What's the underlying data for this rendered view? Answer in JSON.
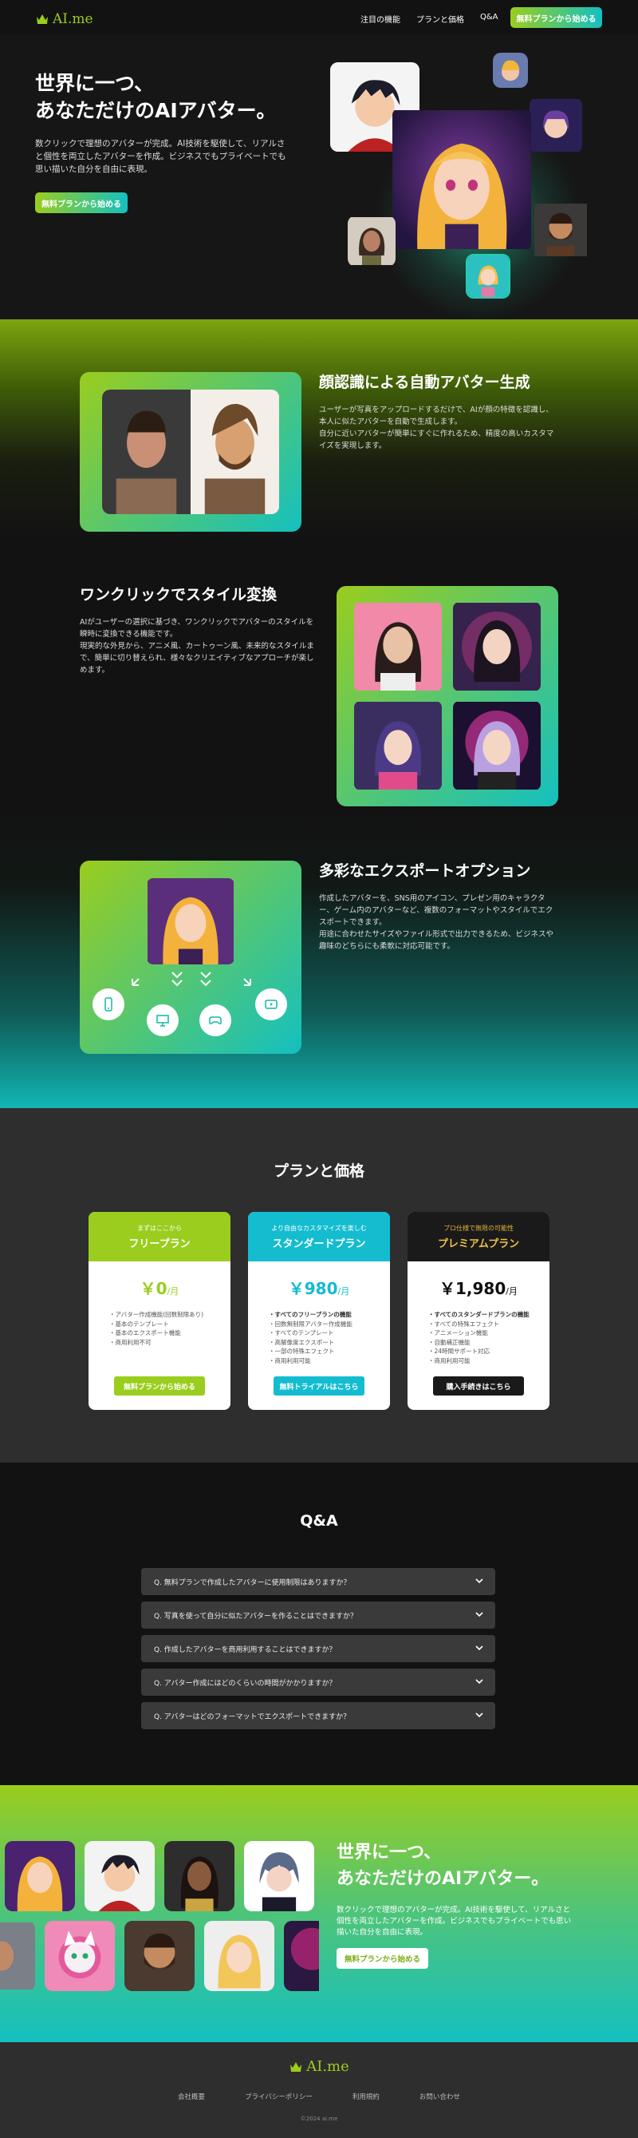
{
  "nav": {
    "logo": "AI.me",
    "links": [
      "注目の機能",
      "プランと価格",
      "Q&A"
    ],
    "cta": "無料プランから始める"
  },
  "hero": {
    "title_line1": "世界に一つ、",
    "title_line2": "あなただけのAIアバター。",
    "description": "数クリックで理想のアバターが完成。AI技術を駆使して、リアルさと個性を両立したアバターを作成。ビジネスでもプライベートでも思い描いた自分を自由に表現。",
    "cta": "無料プランから始める"
  },
  "features": [
    {
      "title": "顔認識による自動アバター生成",
      "text": "ユーザーが写真をアップロードするだけで、AIが顔の特徴を認識し、本人に似たアバターを自動で生成します。\n自分に近いアバターが簡単にすぐに作れるため、精度の高いカスタマイズを実現します。"
    },
    {
      "title": "ワンクリックでスタイル変換",
      "text": "AIがユーザーの選択に基づき、ワンクリックでアバターのスタイルを瞬時に変換できる機能です。\n現実的な外見から、アニメ風、カートゥーン風、未来的なスタイルまで、簡単に切り替えられ、様々なクリエイティブなアプローチが楽しめます。"
    },
    {
      "title": "多彩なエクスポートオプション",
      "text": "作成したアバターを、SNS用のアイコン、プレゼン用のキャラクター、ゲーム内のアバターなど、複数のフォーマットやスタイルでエクスポートできます。\n用途に合わせたサイズやファイル形式で出力できるため、ビジネスや趣味のどちらにも柔軟に対応可能です。"
    }
  ],
  "pricing": {
    "title": "プランと価格",
    "plans": [
      {
        "sub": "まずはここから",
        "name": "フリープラン",
        "price": "￥0",
        "unit": "/月",
        "features": [
          "アバター作成機能(回数制限あり)",
          "基本のテンプレート",
          "基本のエクスポート機能",
          "商用利用不可"
        ],
        "button": "無料プランから始める",
        "accent": "#9acd1e"
      },
      {
        "sub": "より自由なカスタマイズを楽しむ",
        "name": "スタンダードプラン",
        "price": "￥980",
        "unit": "/月",
        "features": [
          "すべてのフリープランの機能",
          "回数無制限アバター作成機能",
          "すべてのテンプレート",
          "高解像度エクスポート",
          "一部の特殊エフェクト",
          "商用利用可能"
        ],
        "button": "無料トライアルはこちら",
        "accent": "#14bcd0"
      },
      {
        "sub": "プロ仕様で無限の可能性",
        "name": "プレミアムプラン",
        "price": "￥1,980",
        "unit": "/月",
        "features": [
          "すべてのスタンダードプランの機能",
          "すべての特殊エフェクト",
          "アニメーション機能",
          "自動補正機能",
          "24時間サポート対応",
          "商用利用可能"
        ],
        "button": "購入手続きはこちら",
        "accent": "#1a1a1a",
        "sub_color": "#e3b33a",
        "name_color": "#f0c24a"
      }
    ]
  },
  "qa": {
    "title": "Q&A",
    "items": [
      "Q. 無料プランで作成したアバターに使用制限はありますか？",
      "Q. 写真を使って自分に似たアバターを作ることはできますか？",
      "Q. 作成したアバターを商用利用することはできますか？",
      "Q. アバター作成にはどのくらいの時間がかかりますか？",
      "Q. アバターはどのフォーマットでエクスポートできますか？"
    ]
  },
  "cta2": {
    "title_line1": "世界に一つ、",
    "title_line2": "あなただけのAIアバター。",
    "description": "数クリックで理想のアバターが完成。AI技術を駆使して、リアルさと個性を両立したアバターを作成。ビジネスでもプライベートでも思い描いた自分を自由に表現。",
    "cta": "無料プランから始める"
  },
  "footer": {
    "logo": "AI.me",
    "links": [
      "会社概要",
      "プライバシーポリシー",
      "利用規約",
      "お問い合わせ"
    ],
    "copyright": "©2024 ai.me"
  },
  "colors": {
    "accent_green": "#9acd1e",
    "accent_teal": "#14c0c0"
  }
}
